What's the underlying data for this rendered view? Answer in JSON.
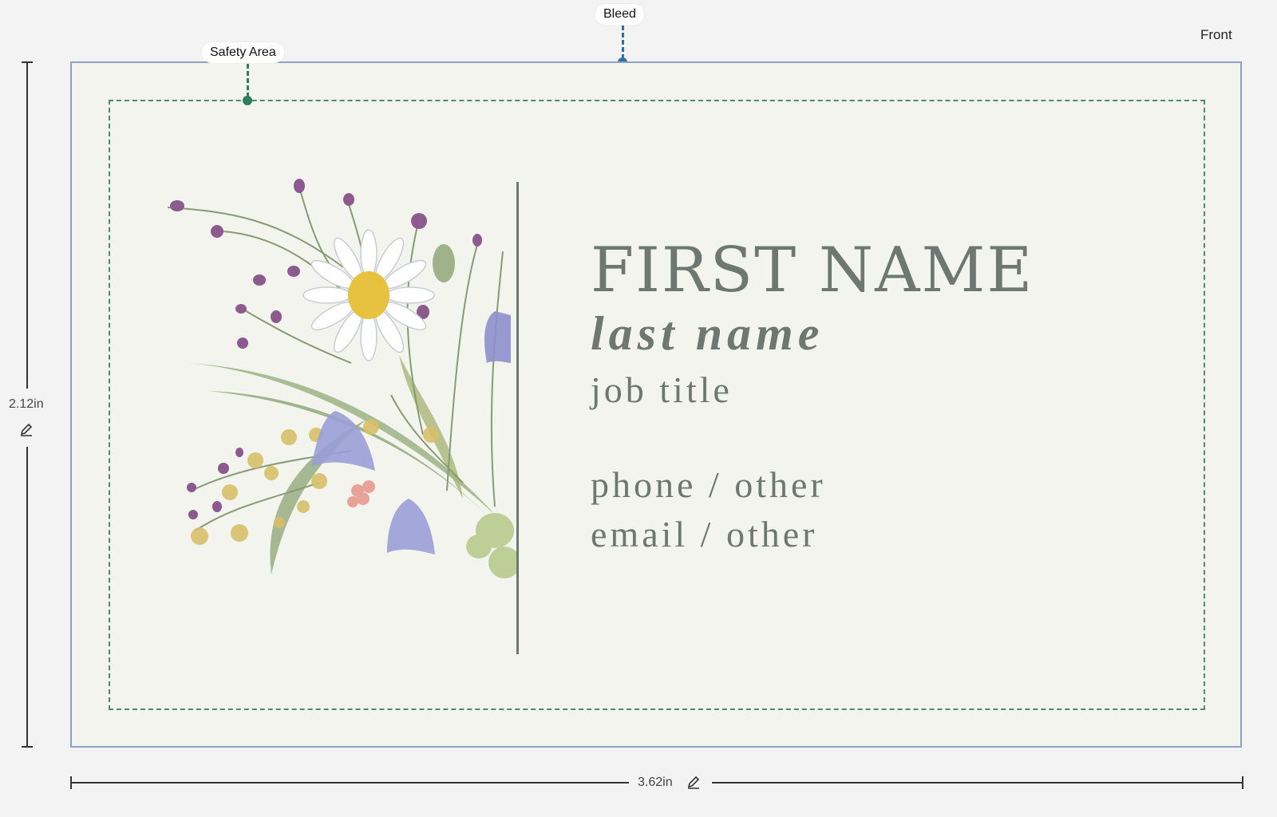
{
  "labels": {
    "bleed": "Bleed",
    "safety_area": "Safety Area",
    "side": "Front"
  },
  "dimensions": {
    "height": "2.12in",
    "width": "3.62in"
  },
  "card": {
    "first_name": "FIRST NAME",
    "last_name": "last name",
    "job_title": "job title",
    "phone": "phone / other",
    "email": "email / other"
  },
  "colors": {
    "bleed_marker": "#2f6db0",
    "safety_marker": "#2e7d5b",
    "text": "#6e7772"
  },
  "icons": {
    "edit_height": "pencil-icon",
    "edit_width": "pencil-icon"
  }
}
